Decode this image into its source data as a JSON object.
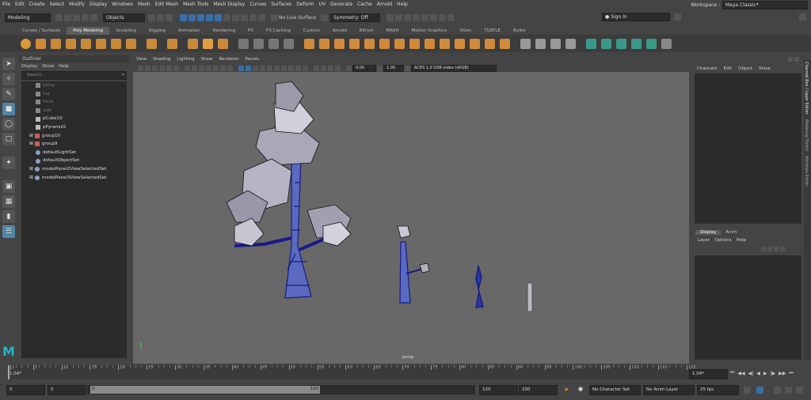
{
  "menubar": {
    "items": [
      "File",
      "Edit",
      "Create",
      "Select",
      "Modify",
      "Display",
      "Windows",
      "Mesh",
      "Edit Mesh",
      "Mesh Tools",
      "Mesh Display",
      "Curves",
      "Surfaces",
      "Deform",
      "UV",
      "Generate",
      "Cache",
      "Arnold",
      "Help"
    ],
    "workspace_label": "Workspace :",
    "workspace_value": "Maya Classic*"
  },
  "statusline": {
    "menuset": "Modeling",
    "selection_mode": "Objects",
    "live_surface": "No Live Surface",
    "symmetry": "Symmetry: Off",
    "sign_in": "Sign In"
  },
  "shelf": {
    "tabs": [
      "Curves / Surfaces",
      "Poly Modeling",
      "Sculpting",
      "Rigging",
      "Animation",
      "Rendering",
      "FX",
      "FX Caching",
      "Custom",
      "Arnold",
      "Bifrost",
      "MASH",
      "Motion Graphics",
      "XGen",
      "TURTLE",
      "Bullet"
    ],
    "active_tab": "Poly Modeling"
  },
  "outliner": {
    "title": "Outliner",
    "menu": [
      "Display",
      "Show",
      "Help"
    ],
    "search_placeholder": "Search...",
    "items": [
      {
        "label": "persp",
        "dim": true,
        "expand": false,
        "icon": "camera-icon"
      },
      {
        "label": "top",
        "dim": true,
        "expand": false,
        "icon": "camera-icon"
      },
      {
        "label": "front",
        "dim": true,
        "expand": false,
        "icon": "camera-icon"
      },
      {
        "label": "side",
        "dim": true,
        "expand": false,
        "icon": "camera-icon"
      },
      {
        "label": "pCube10",
        "dim": false,
        "expand": false,
        "icon": "mesh-icon"
      },
      {
        "label": "pPyramid1",
        "dim": false,
        "expand": false,
        "icon": "mesh-icon"
      },
      {
        "label": "group10",
        "dim": false,
        "expand": true,
        "icon": "group-icon"
      },
      {
        "label": "group9",
        "dim": false,
        "expand": true,
        "icon": "group-icon"
      },
      {
        "label": "defaultLightSet",
        "dim": false,
        "expand": false,
        "icon": "set-icon"
      },
      {
        "label": "defaultObjectSet",
        "dim": false,
        "expand": false,
        "icon": "set-icon"
      },
      {
        "label": "modelPanel2ViewSelectedSet",
        "dim": false,
        "expand": true,
        "icon": "set-icon"
      },
      {
        "label": "modelPanel3ViewSelectedSet",
        "dim": false,
        "expand": true,
        "icon": "set-icon"
      }
    ]
  },
  "viewport": {
    "menu": [
      "View",
      "Shading",
      "Lighting",
      "Show",
      "Renderer",
      "Panels"
    ],
    "exposure": "0.00",
    "gamma": "1.00",
    "colorspace": "ACES 1.0 SDR-video (sRGB)",
    "camera_label": "persp"
  },
  "channelbox": {
    "menu": [
      "Channels",
      "Edit",
      "Object",
      "Show"
    ],
    "layer_tabs": [
      "Display",
      "Anim"
    ],
    "layer_menu": [
      "Layer",
      "Options",
      "Help"
    ],
    "side_tabs": [
      "Channel Box / Layer Editor",
      "Modeling Toolkit",
      "Attribute Editor"
    ]
  },
  "timeslider": {
    "ticks": [
      "1",
      "5",
      "10",
      "15",
      "20",
      "25",
      "30",
      "35",
      "40",
      "45",
      "50",
      "55",
      "60",
      "65",
      "70",
      "75",
      "80",
      "85",
      "90",
      "95",
      "100",
      "105",
      "110",
      "115",
      "120"
    ],
    "current_frame_left": "1.04*",
    "current_frame_right": "1.04*"
  },
  "rangeslider": {
    "start": "0",
    "anim_start": "0",
    "range_start": "0",
    "range_end": "120",
    "end": "120",
    "anim_end": "200",
    "character_set": "No Character Set",
    "anim_layer": "No Anim Layer",
    "fps": "25 fps"
  }
}
